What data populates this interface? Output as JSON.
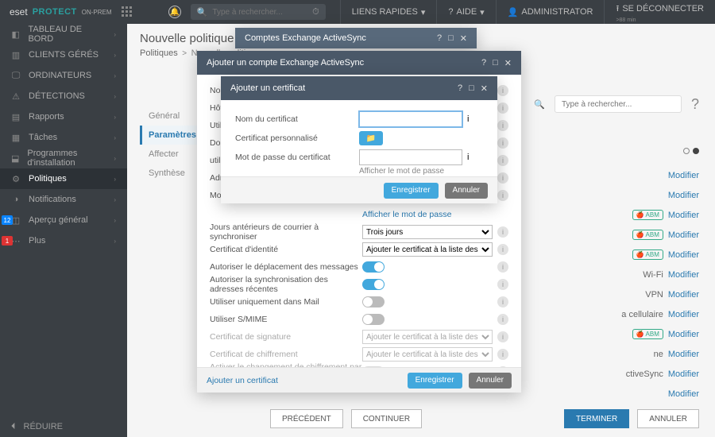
{
  "brand": {
    "text": "PROTECT",
    "vendor": "eset",
    "suffix": "ON-PREM"
  },
  "header": {
    "searchPlaceholder": "Type à rechercher...",
    "links": "LIENS RAPIDES",
    "help": "AIDE",
    "admin": "ADMINISTRATOR",
    "logout": "SE DÉCONNECTER",
    "logoutSub": ">88 min"
  },
  "sidebar": {
    "items": [
      {
        "label": "TABLEAU DE BORD",
        "icon": "◧"
      },
      {
        "label": "CLIENTS GÉRÉS",
        "icon": "▥"
      },
      {
        "label": "ORDINATEURS",
        "icon": "🖵"
      },
      {
        "label": "DÉTECTIONS",
        "icon": "⚠"
      },
      {
        "label": "Rapports",
        "icon": "▤"
      },
      {
        "label": "Tâches",
        "icon": "▦"
      },
      {
        "label": "Programmes d'installation",
        "icon": "⬓"
      },
      {
        "label": "Politiques",
        "icon": "⚙",
        "active": true
      },
      {
        "label": "Notifications",
        "icon": "◑"
      },
      {
        "label": "Aperçu général",
        "icon": "◫",
        "badge": "12"
      },
      {
        "label": "Plus",
        "icon": "⋯",
        "badgeRed": "1"
      }
    ],
    "collapse": "RÉDUIRE"
  },
  "page": {
    "title": "Nouvelle politique",
    "crumbs": {
      "a": "Politiques",
      "b": "Nouvelle politique"
    }
  },
  "contentSearch": "Type à rechercher...",
  "leftTabs": [
    "Général",
    "Paramètres",
    "Affecter",
    "Synthèse"
  ],
  "rightRows": [
    {
      "label": "",
      "badge": false,
      "a": "Modifier"
    },
    {
      "label": "",
      "badge": false,
      "a": "Modifier"
    },
    {
      "label": "",
      "badge": true,
      "a": "Modifier"
    },
    {
      "label": "",
      "badge": true,
      "a": "Modifier"
    },
    {
      "label": "",
      "badge": true,
      "a": "Modifier"
    },
    {
      "label": "Wi-Fi",
      "badge": false,
      "a": "Modifier"
    },
    {
      "label": "VPN",
      "badge": false,
      "a": "Modifier"
    },
    {
      "label": "a cellulaire",
      "badge": false,
      "a": "Modifier"
    },
    {
      "label": "",
      "badge": true,
      "a": "Modifier"
    },
    {
      "label": "ne",
      "badge": false,
      "a": "Modifier"
    },
    {
      "label": "ctiveSync",
      "badge": false,
      "a": "Modifier"
    },
    {
      "label": "",
      "badge": false,
      "a": "Modifier"
    }
  ],
  "wizard": {
    "prev": "PRÉCÉDENT",
    "cont": "CONTINUER",
    "finish": "TERMINER",
    "cancel": "ANNULER"
  },
  "modal1": {
    "title": "Comptes Exchange ActiveSync"
  },
  "modal2": {
    "title": "Ajouter un compte Exchange ActiveSync",
    "shortLabels": [
      "Nom",
      "Hôt",
      "Util",
      "Dom",
      "util",
      "Adr",
      "Mot"
    ],
    "showPwd": "Afficher le mot de passe",
    "fields": {
      "sync": {
        "label": "Jours antérieurs de courrier à synchroniser",
        "value": "Trois jours"
      },
      "identity": {
        "label": "Certificat d'identité",
        "value": "Ajouter le certificat à la liste des certificats"
      },
      "allowMove": "Autoriser le déplacement des messages",
      "allowRecentSync": "Autoriser la synchronisation des adresses récentes",
      "onlyMail": "Utiliser uniquement dans Mail",
      "smime": "Utiliser S/MIME",
      "sigCert": {
        "label": "Certificat de signature",
        "value": "Ajouter le certificat à la liste des certificats"
      },
      "encCert": {
        "label": "Certificat de chiffrement",
        "value": "Ajouter le certificat à la liste des certificats"
      },
      "perMsgEnc": "Activer le changement de chiffrement par message"
    },
    "addCert": "Ajouter un certificat",
    "save": "Enregistrer",
    "cancel": "Annuler"
  },
  "modal3": {
    "title": "Ajouter un certificat",
    "name": "Nom du certificat",
    "custom": "Certificat personnalisé",
    "pwd": "Mot de passe du certificat",
    "show": "Afficher le mot de passe",
    "save": "Enregistrer",
    "cancel": "Annuler"
  }
}
